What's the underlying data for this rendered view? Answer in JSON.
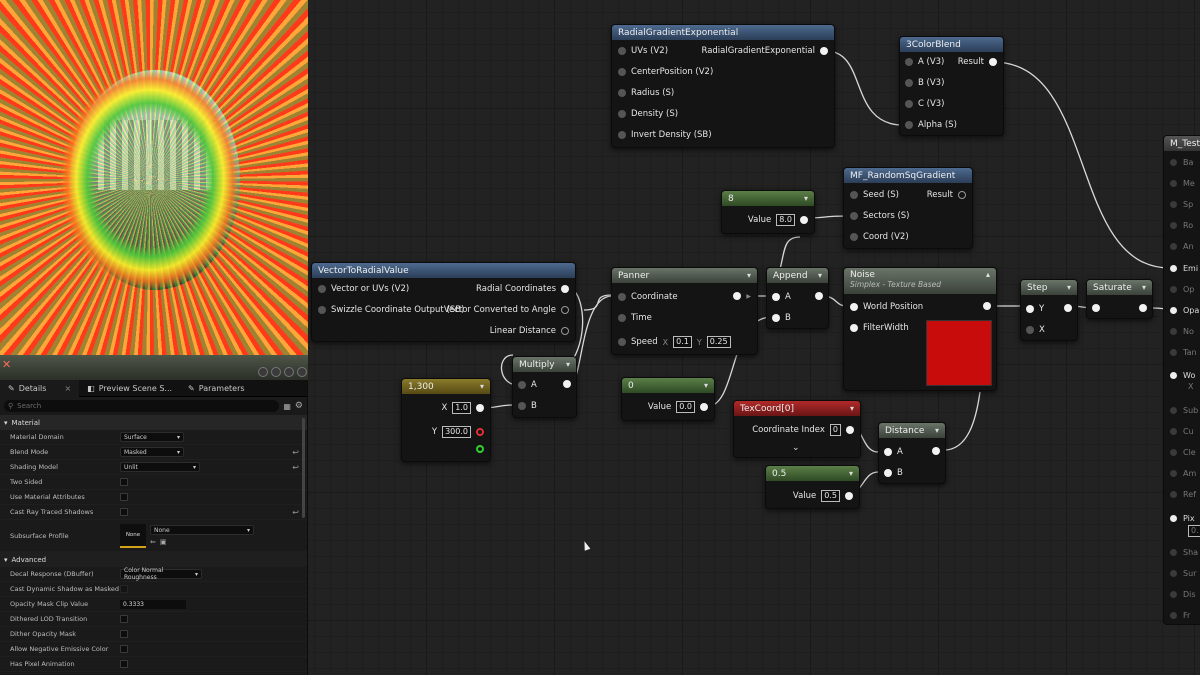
{
  "details_panel": {
    "tabs": [
      {
        "label": "Details",
        "closable": true
      },
      {
        "label": "Preview Scene S..."
      },
      {
        "label": "Parameters"
      }
    ],
    "search_placeholder": "Search",
    "sections": {
      "material": {
        "title": "Material",
        "material_domain": {
          "label": "Material Domain",
          "value": "Surface"
        },
        "blend_mode": {
          "label": "Blend Mode",
          "value": "Masked"
        },
        "shading_model": {
          "label": "Shading Model",
          "value": "Unlit"
        },
        "two_sided": {
          "label": "Two Sided"
        },
        "use_material_attributes": {
          "label": "Use Material Attributes"
        },
        "cast_ray_traced_shadows": {
          "label": "Cast Ray Traced Shadows"
        },
        "subsurface_profile": {
          "label": "Subsurface Profile",
          "swatch": "None",
          "value": "None"
        }
      },
      "advanced": {
        "title": "Advanced",
        "decal_response": {
          "label": "Decal Response (DBuffer)",
          "value": "Color Normal Roughness"
        },
        "cast_dynamic_shadow": {
          "label": "Cast Dynamic Shadow as Masked"
        },
        "opacity_mask_clip": {
          "label": "Opacity Mask Clip Value",
          "value": "0.3333"
        },
        "dithered_lod": {
          "label": "Dithered LOD Transition"
        },
        "dither_opacity": {
          "label": "Dither Opacity Mask"
        },
        "allow_negative": {
          "label": "Allow Negative Emissive Color"
        },
        "pixel_animation": {
          "label": "Has Pixel Animation"
        }
      }
    }
  },
  "graph": {
    "radial_gradient": {
      "title": "RadialGradientExponential",
      "inputs": [
        "UVs (V2)",
        "CenterPosition (V2)",
        "Radius (S)",
        "Density (S)",
        "Invert Density (SB)"
      ],
      "output": "RadialGradientExponential"
    },
    "color_blend": {
      "title": "3ColorBlend",
      "inputs": [
        "A (V3)",
        "B (V3)",
        "C (V3)",
        "Alpha (S)"
      ],
      "output": "Result"
    },
    "random_sq": {
      "title": "MF_RandomSqGradient",
      "inputs": [
        "Seed (S)",
        "Sectors (S)",
        "Coord (V2)"
      ],
      "output": "Result"
    },
    "const_8": {
      "title": "8",
      "value_label": "Value",
      "value": "8.0"
    },
    "vector_radial": {
      "title": "VectorToRadialValue",
      "inputs": [
        "Vector or UVs (V2)",
        "Swizzle Coordinate Output (SB)"
      ],
      "outputs": [
        "Radial Coordinates",
        "Vector Converted to Angle",
        "Linear Distance"
      ]
    },
    "panner": {
      "title": "Panner",
      "inputs": [
        "Coordinate",
        "Time",
        "Speed"
      ],
      "speed_x_label": "X",
      "speed_x": "0.1",
      "speed_y_label": "Y",
      "speed_y": "0.25"
    },
    "append": {
      "title": "Append",
      "inputs": [
        "A",
        "B"
      ]
    },
    "noise": {
      "title": "Noise",
      "subtitle": "Simplex - Texture Based",
      "inputs": [
        "World Position",
        "FilterWidth"
      ],
      "preview_color": "#c80c0c"
    },
    "step": {
      "title": "Step",
      "inputs": [
        "Y",
        "X"
      ]
    },
    "saturate": {
      "title": "Saturate"
    },
    "multiply": {
      "title": "Multiply",
      "inputs": [
        "A",
        "B"
      ]
    },
    "const_1300": {
      "title": "1,300",
      "x_label": "X",
      "x_value": "1.0",
      "y_label": "Y",
      "y_value": "300.0"
    },
    "const_0": {
      "title": "0",
      "value_label": "Value",
      "value": "0.0"
    },
    "texcoord": {
      "title": "TexCoord[0]",
      "label": "Coordinate Index",
      "value": "0"
    },
    "distance": {
      "title": "Distance",
      "inputs": [
        "A",
        "B"
      ]
    },
    "const_05": {
      "title": "0.5",
      "value_label": "Value",
      "value": "0.5"
    },
    "m_test": {
      "title": "M_Test",
      "pins": [
        "Ba",
        "Me",
        "Sp",
        "Ro",
        "An",
        "Emi",
        "Op",
        "Opa",
        "No",
        "Tan",
        "Wo",
        "X",
        "Sub",
        "Cu",
        "Cle",
        "Am",
        "Ref",
        "Pix",
        "0.",
        "Sha",
        "Sur",
        "Dis",
        "Fr"
      ]
    }
  }
}
